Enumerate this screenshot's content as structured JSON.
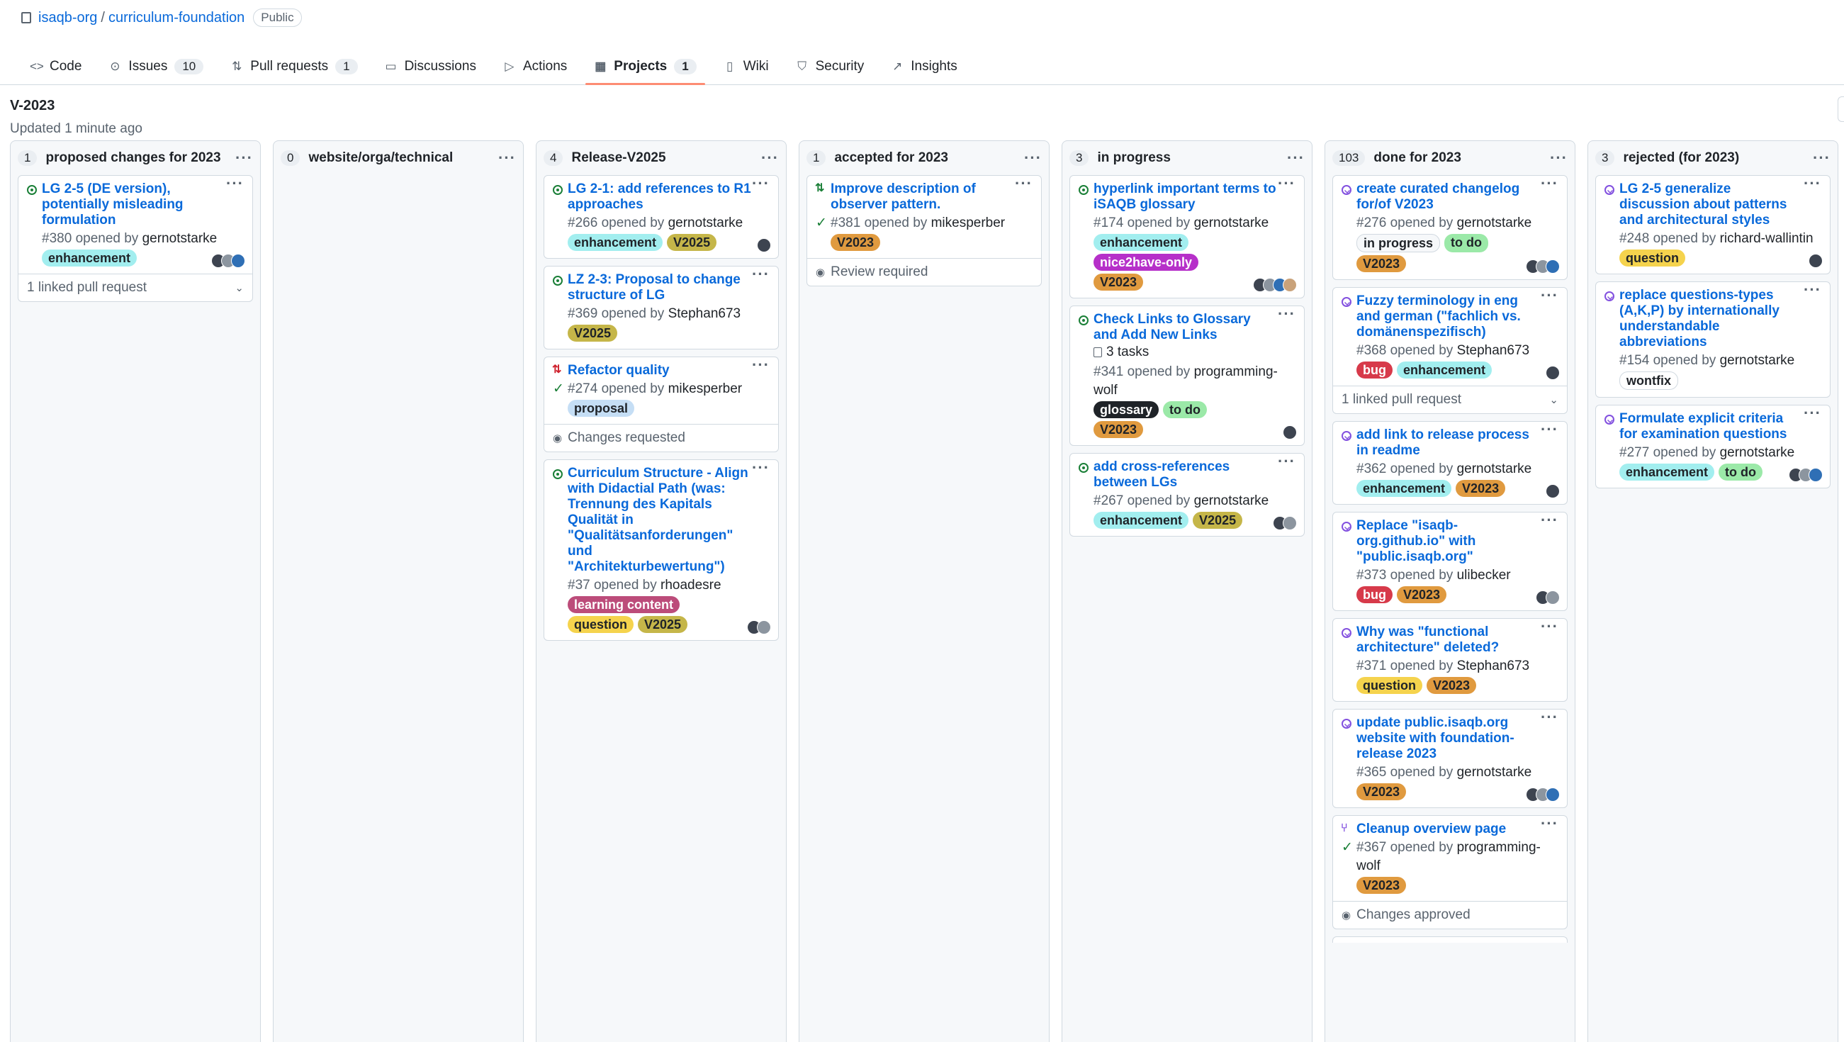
{
  "repo": {
    "owner": "isaqb-org",
    "separator": "/",
    "name": "curriculum-foundation",
    "visibility": "Public"
  },
  "nav": {
    "code": {
      "label": "Code",
      "icon": "code-icon"
    },
    "issues": {
      "label": "Issues",
      "count": "10",
      "icon": "issue-icon"
    },
    "pulls": {
      "label": "Pull requests",
      "count": "1",
      "icon": "pull-request-icon"
    },
    "discussions": {
      "label": "Discussions",
      "icon": "discussion-icon"
    },
    "actions": {
      "label": "Actions",
      "icon": "play-icon"
    },
    "projects": {
      "label": "Projects",
      "count": "1",
      "icon": "table-icon"
    },
    "wiki": {
      "label": "Wiki",
      "icon": "book-icon"
    },
    "security": {
      "label": "Security",
      "icon": "shield-icon"
    },
    "insights": {
      "label": "Insights",
      "icon": "graph-icon"
    }
  },
  "view": {
    "title": "V-2023",
    "updated": "Updated 1 minute ago"
  },
  "colors": {
    "accent": "#0969da",
    "tab_underline": "#fd8c73",
    "open": "#1a7f37",
    "closed": "#8250df",
    "draft": "#cf222e"
  },
  "columns": [
    {
      "count": "1",
      "name": "proposed changes for 2023",
      "cards": [
        {
          "status": "open",
          "title": "LG 2-5 (DE version), potentially misleading formulation",
          "number": "#380",
          "opened": "opened by",
          "author": "gernotstarke",
          "labels": [
            {
              "text": "enhancement",
              "bg": "#a2eeef",
              "fg": "#1f2328"
            }
          ],
          "avatars": 3,
          "footer": "1 linked pull request",
          "footer_icon": "",
          "footer_chevron": "⌄"
        }
      ]
    },
    {
      "count": "0",
      "name": "website/orga/technical",
      "cards": []
    },
    {
      "count": "4",
      "name": "Release-V2025",
      "cards": [
        {
          "status": "open",
          "title": "LG 2-1: add references to R1 approaches",
          "number": "#266",
          "opened": "opened by",
          "author": "gernotstarke",
          "labels": [
            {
              "text": "enhancement",
              "bg": "#a2eeef",
              "fg": "#1f2328"
            },
            {
              "text": "V2025",
              "bg": "#c5b649",
              "fg": "#1f2328"
            }
          ],
          "avatars": 1
        },
        {
          "status": "open",
          "title": "LZ 2-3: Proposal to change structure of LG",
          "number": "#369",
          "opened": "opened by",
          "author": "Stephan673",
          "labels": [
            {
              "text": "V2025",
              "bg": "#c5b649",
              "fg": "#1f2328"
            }
          ],
          "avatars": 0
        },
        {
          "status": "pr-draft",
          "title": "Refactor quality",
          "number": "#274",
          "opened": "opened by",
          "author": "mikesperber",
          "check": true,
          "labels": [
            {
              "text": "proposal",
              "bg": "#c5def5",
              "fg": "#1f2328"
            }
          ],
          "avatars": 0,
          "footer": "Changes requested",
          "footer_icon": "◉"
        },
        {
          "status": "open",
          "title": "Curriculum Structure - Align with Didactial Path (was: Trennung des Kapitals Qualität in \"Qualitätsanforderungen\" und \"Architekturbewertung\")",
          "number": "#37",
          "opened": "opened by",
          "author": "rhoadesre",
          "labels": [
            {
              "text": "learning content",
              "bg": "#bc4c7a",
              "fg": "#ffffff"
            },
            {
              "text": "question",
              "bg": "#f5d34d",
              "fg": "#1f2328"
            },
            {
              "text": "V2025",
              "bg": "#c5b649",
              "fg": "#1f2328"
            }
          ],
          "avatars": 2
        }
      ]
    },
    {
      "count": "1",
      "name": "accepted for 2023",
      "cards": [
        {
          "status": "pr-open",
          "title": "Improve description of observer pattern.",
          "number": "#381",
          "opened": "opened by",
          "author": "mikesperber",
          "check": true,
          "labels": [
            {
              "text": "V2023",
              "bg": "#e09a3f",
              "fg": "#1f2328"
            }
          ],
          "avatars": 0,
          "footer": "Review required",
          "footer_icon": "◉"
        }
      ]
    },
    {
      "count": "3",
      "name": "in progress",
      "cards": [
        {
          "status": "open",
          "title": "hyperlink important terms to iSAQB glossary",
          "number": "#174",
          "opened": "opened by",
          "author": "gernotstarke",
          "labels": [
            {
              "text": "enhancement",
              "bg": "#a2eeef",
              "fg": "#1f2328"
            },
            {
              "text": "nice2have-only",
              "bg": "#b630c9",
              "fg": "#ffffff"
            },
            {
              "text": "V2023",
              "bg": "#e09a3f",
              "fg": "#1f2328"
            }
          ],
          "avatars": 4
        },
        {
          "status": "open",
          "title": "Check Links to Glossary and Add New Links",
          "tasks": "3 tasks",
          "number": "#341",
          "opened": "opened by",
          "author": "programming-wolf",
          "labels": [
            {
              "text": "glossary",
              "bg": "#1f2328",
              "fg": "#ffffff"
            },
            {
              "text": "to do",
              "bg": "#9be9a8",
              "fg": "#1f2328"
            },
            {
              "text": "V2023",
              "bg": "#e09a3f",
              "fg": "#1f2328"
            }
          ],
          "avatars": 1
        },
        {
          "status": "open",
          "title": "add cross-references between LGs",
          "number": "#267",
          "opened": "opened by",
          "author": "gernotstarke",
          "labels": [
            {
              "text": "enhancement",
              "bg": "#a2eeef",
              "fg": "#1f2328"
            },
            {
              "text": "V2025",
              "bg": "#c5b649",
              "fg": "#1f2328"
            }
          ],
          "avatars": 2
        }
      ]
    },
    {
      "count": "103",
      "name": "done for 2023",
      "cards": [
        {
          "status": "done",
          "title": "create curated changelog for/of V2023",
          "number": "#276",
          "opened": "opened by",
          "author": "gernotstarke",
          "labels": [
            {
              "text": "in progress",
              "bg": "#f6f8fa",
              "fg": "#1f2328"
            },
            {
              "text": "to do",
              "bg": "#9be9a8",
              "fg": "#1f2328"
            },
            {
              "text": "V2023",
              "bg": "#e09a3f",
              "fg": "#1f2328"
            }
          ],
          "avatars": 3
        },
        {
          "status": "done",
          "title": "Fuzzy terminology in eng and german (\"fachlich vs. domänenspezifisch)",
          "number": "#368",
          "opened": "opened by",
          "author": "Stephan673",
          "labels": [
            {
              "text": "bug",
              "bg": "#d73a4a",
              "fg": "#ffffff"
            },
            {
              "text": "enhancement",
              "bg": "#a2eeef",
              "fg": "#1f2328"
            }
          ],
          "avatars": 1,
          "footer": "1 linked pull request",
          "footer_icon": "",
          "footer_chevron": "⌄"
        },
        {
          "status": "done",
          "title": "add link to release process in readme",
          "number": "#362",
          "opened": "opened by",
          "author": "gernotstarke",
          "labels": [
            {
              "text": "enhancement",
              "bg": "#a2eeef",
              "fg": "#1f2328"
            },
            {
              "text": "V2023",
              "bg": "#e09a3f",
              "fg": "#1f2328"
            }
          ],
          "avatars": 1
        },
        {
          "status": "done",
          "title": "Replace \"isaqb-org.github.io\" with \"public.isaqb.org\"",
          "number": "#373",
          "opened": "opened by",
          "author": "ulibecker",
          "labels": [
            {
              "text": "bug",
              "bg": "#d73a4a",
              "fg": "#ffffff"
            },
            {
              "text": "V2023",
              "bg": "#e09a3f",
              "fg": "#1f2328"
            }
          ],
          "avatars": 2
        },
        {
          "status": "done",
          "title": "Why was \"functional architecture\" deleted?",
          "number": "#371",
          "opened": "opened by",
          "author": "Stephan673",
          "labels": [
            {
              "text": "question",
              "bg": "#f5d34d",
              "fg": "#1f2328"
            },
            {
              "text": "V2023",
              "bg": "#e09a3f",
              "fg": "#1f2328"
            }
          ],
          "avatars": 0
        },
        {
          "status": "done",
          "title": "update public.isaqb.org website with foundation-release 2023",
          "number": "#365",
          "opened": "opened by",
          "author": "gernotstarke",
          "labels": [
            {
              "text": "V2023",
              "bg": "#e09a3f",
              "fg": "#1f2328"
            }
          ],
          "avatars": 3
        },
        {
          "status": "pr-merged",
          "title": "Cleanup overview page",
          "number": "#367",
          "opened": "opened by",
          "author": "programming-wolf",
          "check": true,
          "labels": [
            {
              "text": "V2023",
              "bg": "#e09a3f",
              "fg": "#1f2328"
            }
          ],
          "avatars": 0,
          "footer": "Changes approved",
          "footer_icon": "◉"
        }
      ]
    },
    {
      "count": "3",
      "name": "rejected (for 2023)",
      "cards": [
        {
          "status": "done",
          "title": "LG 2-5 generalize discussion about patterns and architectural styles",
          "number": "#248",
          "opened": "opened by",
          "author": "richard-wallintin",
          "labels": [
            {
              "text": "question",
              "bg": "#f5d34d",
              "fg": "#1f2328"
            }
          ],
          "avatars": 1
        },
        {
          "status": "done",
          "title": "replace questions-types (A,K,P) by internationally understandable abbreviations",
          "number": "#154",
          "opened": "opened by",
          "author": "gernotstarke",
          "labels": [
            {
              "text": "wontfix",
              "bg": "#ffffff",
              "fg": "#1f2328"
            }
          ],
          "avatars": 0
        },
        {
          "status": "done",
          "title": "Formulate explicit criteria for examination questions",
          "number": "#277",
          "opened": "opened by",
          "author": "gernotstarke",
          "labels": [
            {
              "text": "enhancement",
              "bg": "#a2eeef",
              "fg": "#1f2328"
            },
            {
              "text": "to do",
              "bg": "#9be9a8",
              "fg": "#1f2328"
            }
          ],
          "avatars": 3
        }
      ]
    }
  ],
  "menu_glyph": "···"
}
